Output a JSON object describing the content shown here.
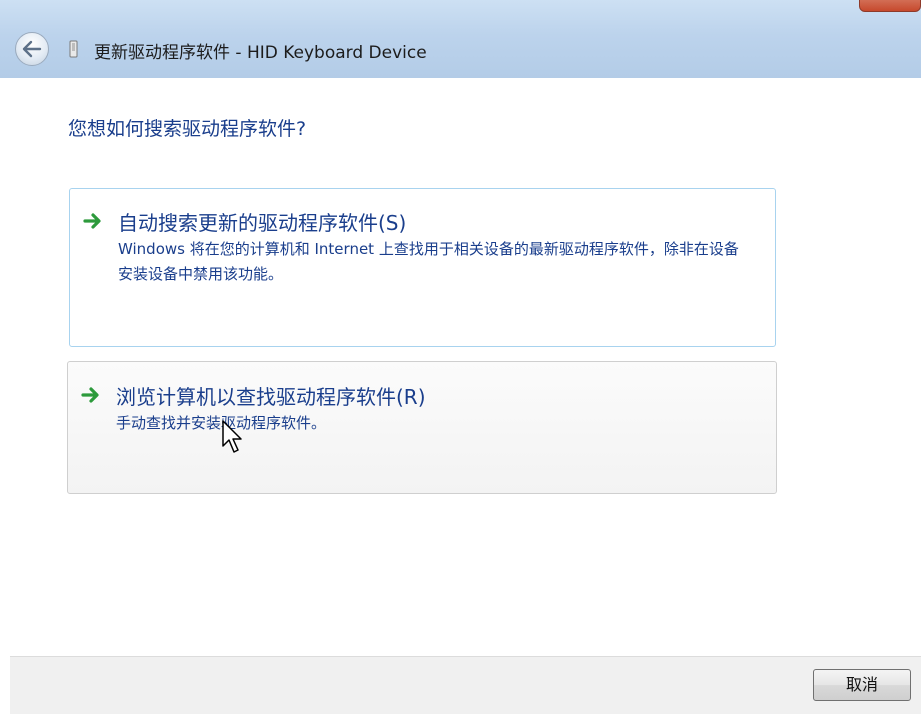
{
  "window": {
    "title": "更新驱动程序软件 - HID Keyboard Device"
  },
  "main": {
    "question": "您想如何搜索驱动程序软件?",
    "options": [
      {
        "title": "自动搜索更新的驱动程序软件(S)",
        "description": "Windows 将在您的计算机和 Internet 上查找用于相关设备的最新驱动程序软件，除非在设备安装设备中禁用该功能。",
        "icon": "green-arrow-icon"
      },
      {
        "title": "浏览计算机以查找驱动程序软件(R)",
        "description": "手动查找并安装驱动程序软件。",
        "icon": "green-arrow-icon"
      }
    ]
  },
  "footer": {
    "cancel_label": "取消"
  },
  "colors": {
    "title_bar": "#bcd3ec",
    "link_text": "#1a3e8c",
    "arrow": "#2d9a3c",
    "selected_border": "#a8d3ef",
    "footer_bg": "#f0f0f0"
  }
}
